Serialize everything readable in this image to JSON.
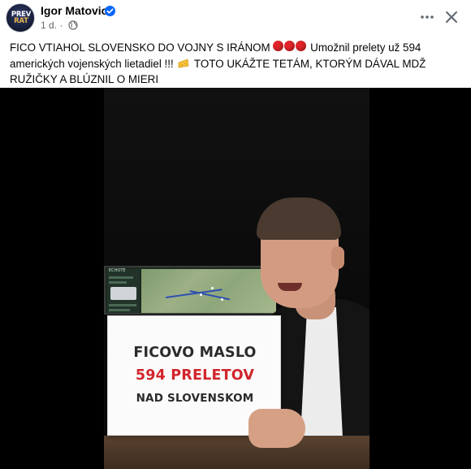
{
  "post": {
    "author": "Igor Matovic",
    "verified": true,
    "avatar_text_line1": "PREV",
    "avatar_text_line2": "RAT",
    "time": "1 d.",
    "separator": "·",
    "privacy_icon": "globe-icon",
    "more_icon": "more-horizontal-icon",
    "close_icon": "close-icon",
    "text_part1": "FICO VTIAHOL SLOVENSKO DO VOJNY S IRÁNOM",
    "text_part2": "Umožnil prelety už 594 amerických vojenských lietadiel !!!",
    "text_part3": "TOTO UKÁŽTE TETÁM, KTORÝM DÁVAL MDŽ RUŽIČKY A BLÚZNIL O MIERI",
    "emoji_dots": "red-circle-icon x3",
    "emoji_cheese": "cheese-icon"
  },
  "video": {
    "sign_line1": "FICOVO MASLO",
    "sign_line2": "594 PRELETOV",
    "sign_line3": "NAD SLOVENSKOM",
    "sign_line2_color": "#d2242b",
    "monitor_label": "ECHOTE"
  },
  "colors": {
    "verified_blue": "#0866ff",
    "muted_text": "#65676b",
    "alert_red": "#e0242a"
  }
}
